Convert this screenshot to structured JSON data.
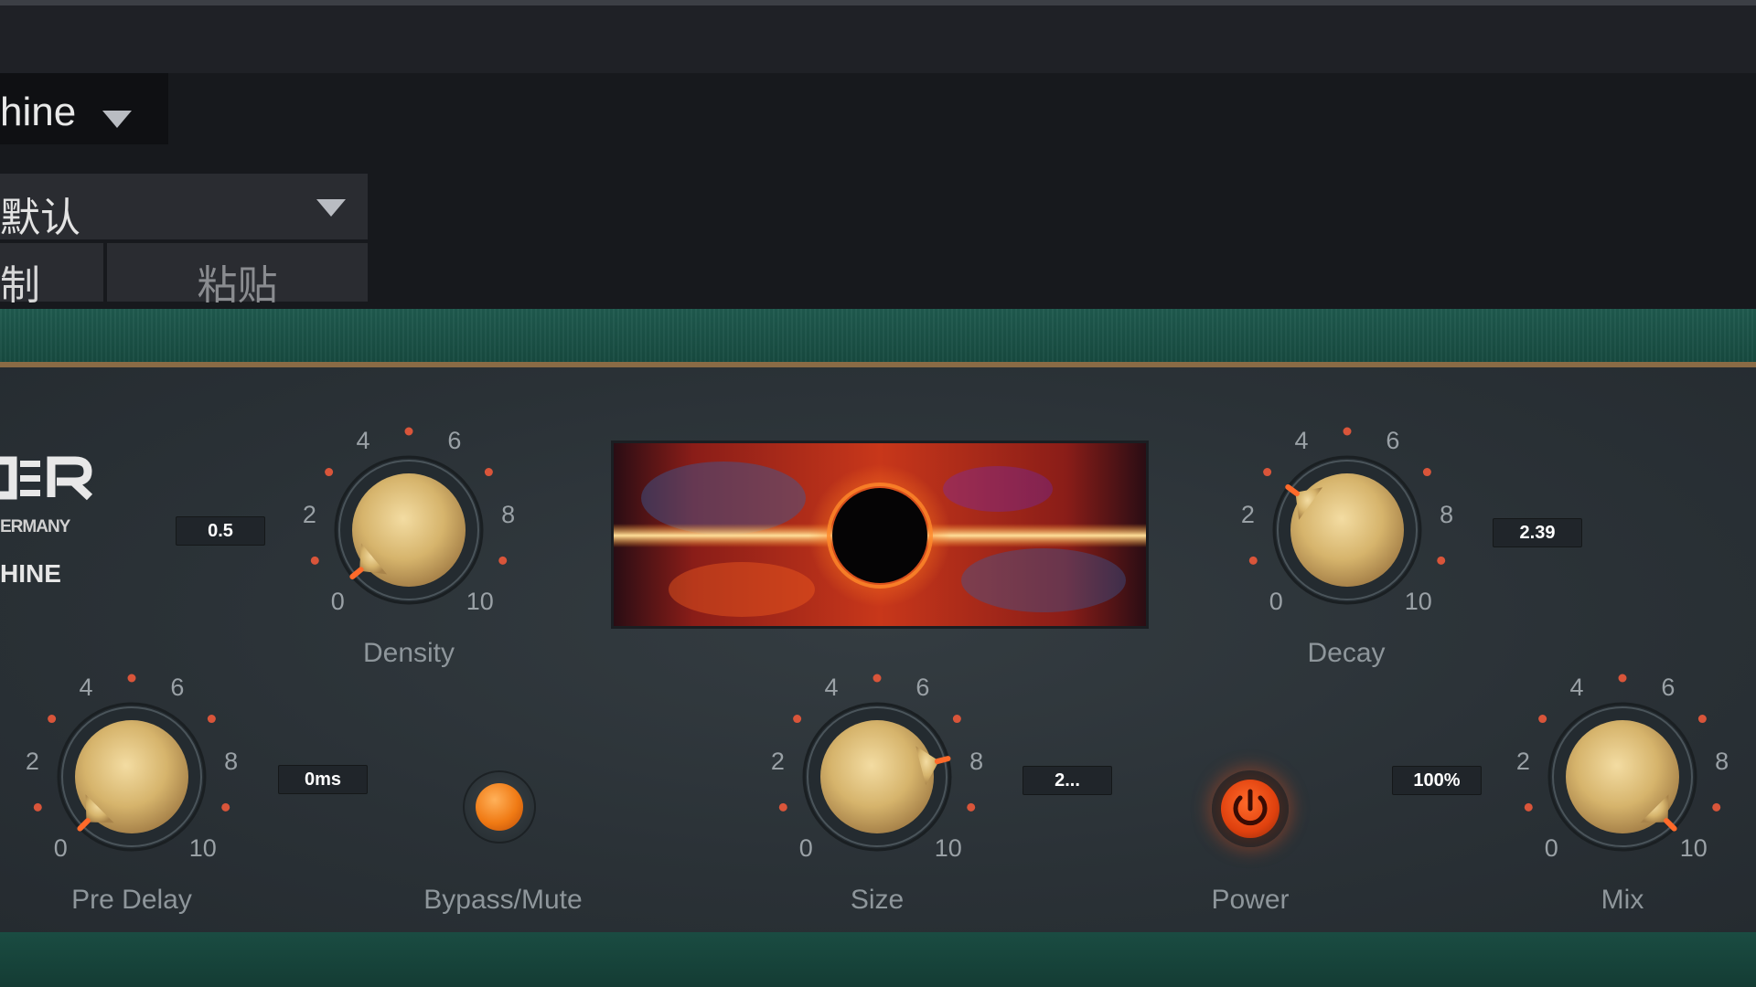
{
  "host": {
    "plugin_name": "hine",
    "preset": "默认",
    "copy_label": "制",
    "paste_label": "粘贴"
  },
  "plugin": {
    "logo_sub": "ERMANY",
    "logo_name": "HINE",
    "colors": {
      "gold": "#d6b46c",
      "panel": "#2b3237",
      "green": "#1e5448",
      "tick": "#d9553a",
      "power": "#f0521c"
    },
    "knobs": {
      "density": {
        "label": "Density",
        "value": "0.5",
        "scale": [
          "0",
          "2",
          "4",
          "6",
          "8",
          "10"
        ],
        "level": 0.02
      },
      "decay": {
        "label": "Decay",
        "value": "2.39",
        "scale": [
          "0",
          "2",
          "4",
          "6",
          "8",
          "10"
        ],
        "level": 0.3
      },
      "pre_delay": {
        "label": "Pre Delay",
        "value": "0ms",
        "scale": [
          "0",
          "2",
          "4",
          "6",
          "8",
          "10"
        ],
        "level": 0.0
      },
      "size": {
        "label": "Size",
        "value": "2...",
        "scale": [
          "0",
          "2",
          "4",
          "6",
          "8",
          "10"
        ],
        "level": 0.78
      },
      "mix": {
        "label": "Mix",
        "value": "100%",
        "scale": [
          "0",
          "2",
          "4",
          "6",
          "8",
          "10"
        ],
        "level": 1.0
      }
    },
    "bypass_label": "Bypass/Mute",
    "power_label": "Power"
  }
}
